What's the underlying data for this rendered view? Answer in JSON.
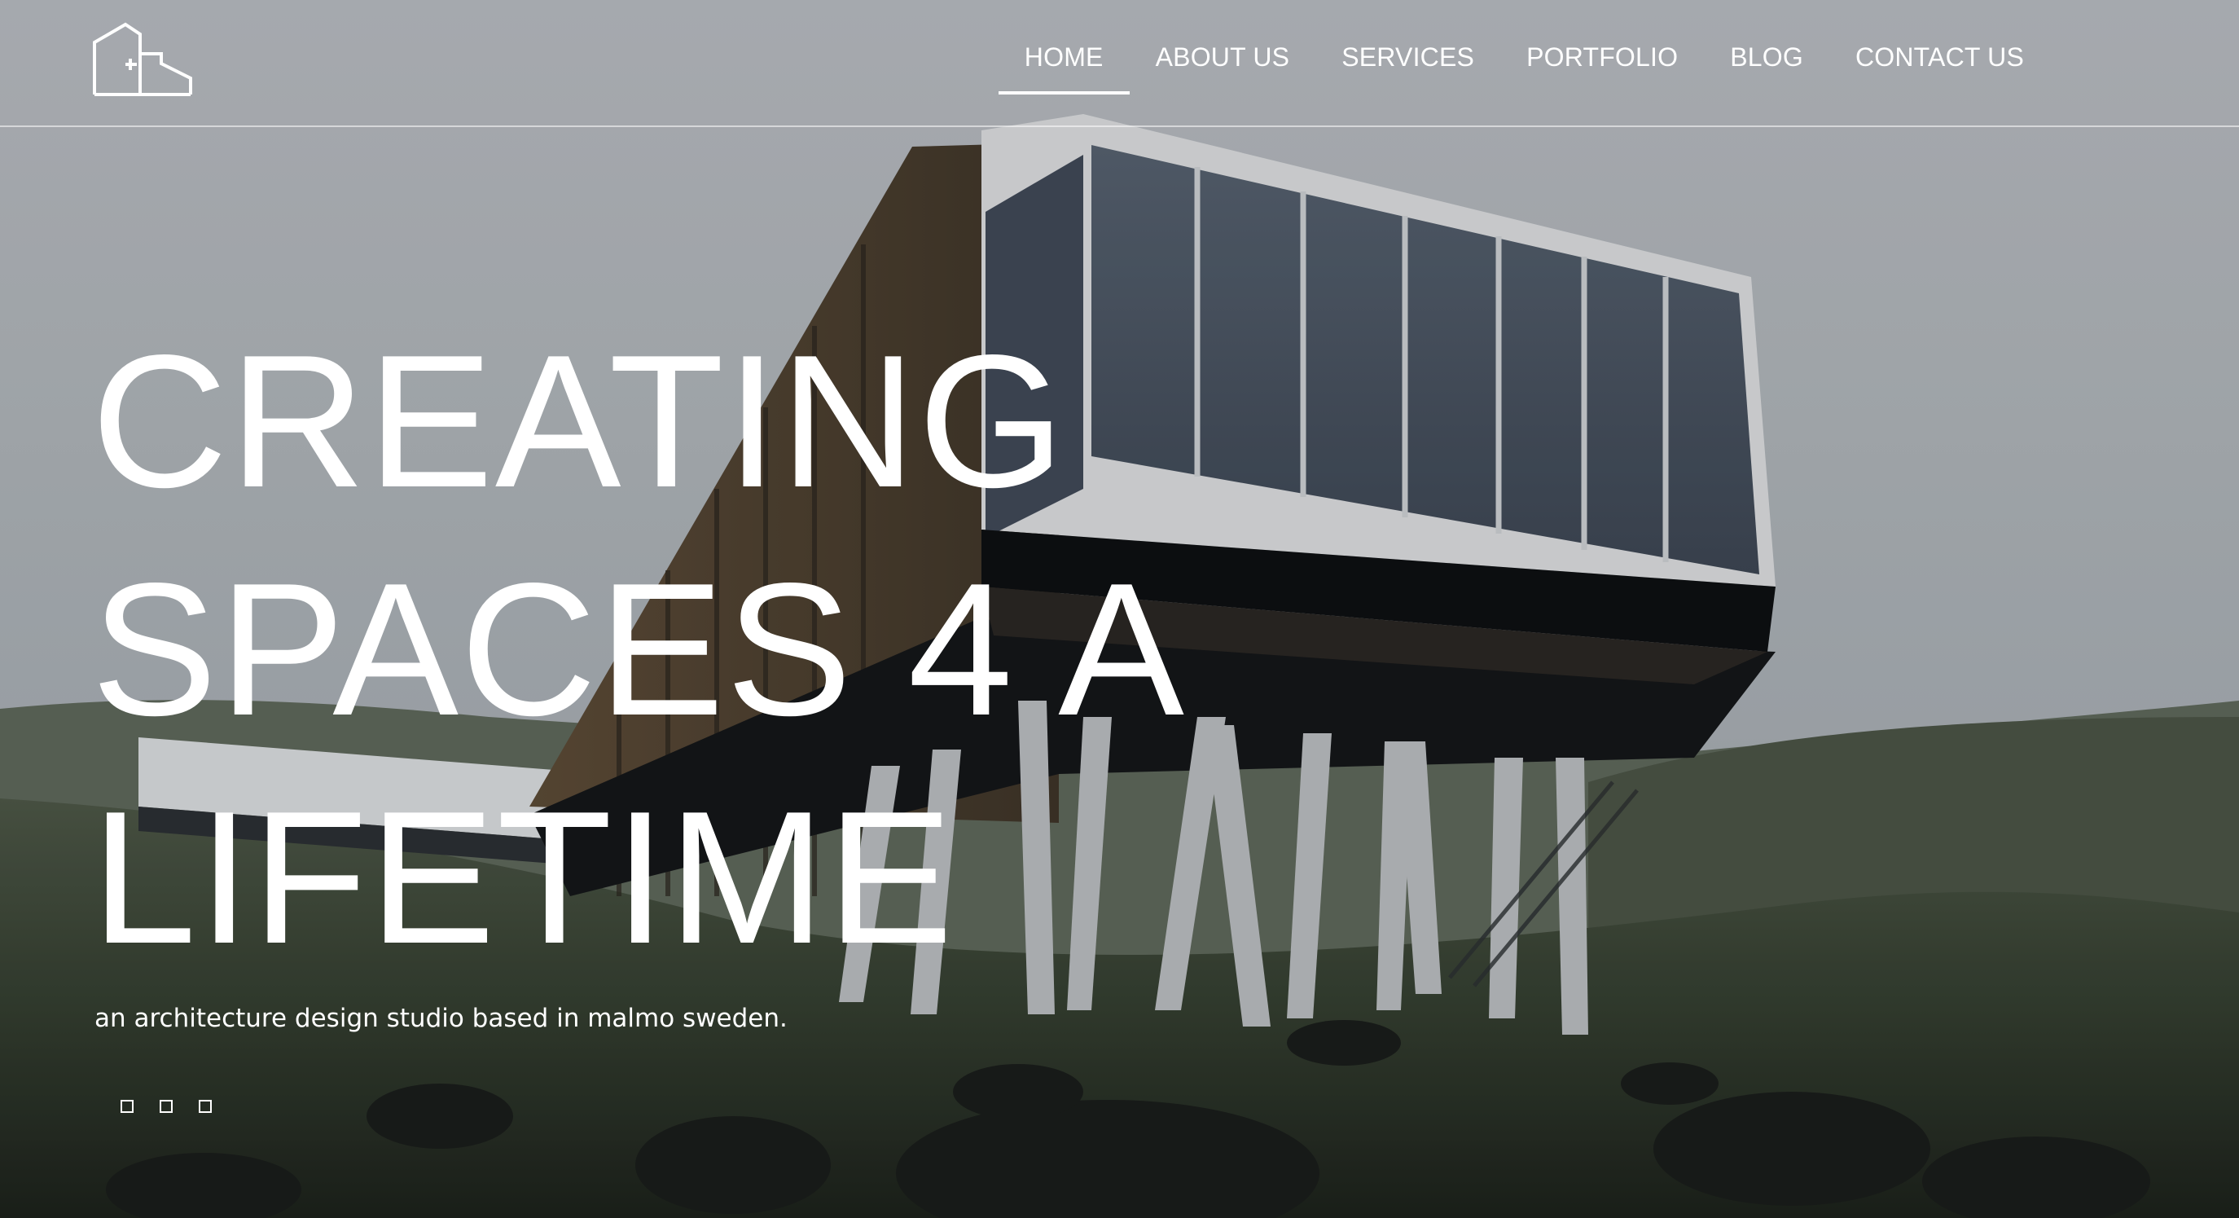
{
  "header": {
    "logo_icon": "building-outline-logo",
    "nav": [
      {
        "label": "HOME",
        "active": true
      },
      {
        "label": "ABOUT US",
        "active": false
      },
      {
        "label": "SERVICES",
        "active": false
      },
      {
        "label": "PORTFOLIO",
        "active": false
      },
      {
        "label": "BLOG",
        "active": false
      },
      {
        "label": "CONTACT US",
        "active": false
      }
    ]
  },
  "hero": {
    "headline_lines": [
      "CREATING",
      "SPACES 4 A",
      "LIFETIME"
    ],
    "tagline": "an architecture design studio based in malmo sweden.",
    "slide_count": 3
  },
  "colors": {
    "text": "#ffffff",
    "sky": "#b3b8bc",
    "ground": "#2e3a2c",
    "glass": "#4a5566"
  }
}
